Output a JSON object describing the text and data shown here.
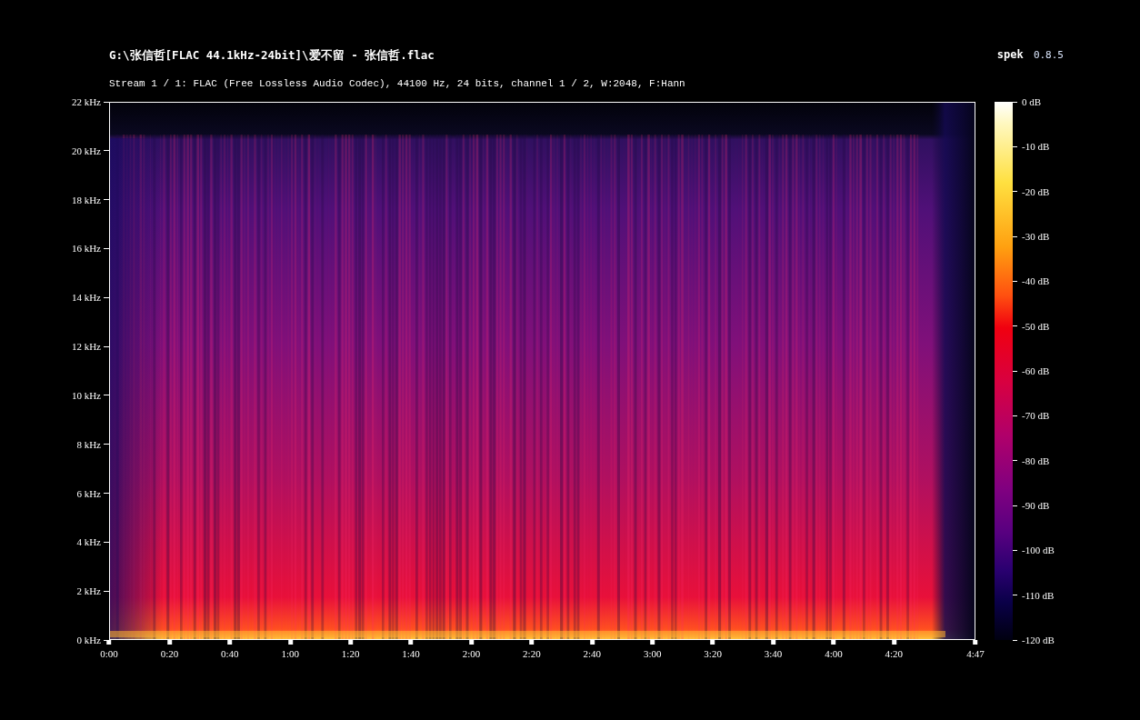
{
  "header": {
    "title": "G:\\张信哲[FLAC 44.1kHz-24bit]\\爱不留 - 张信哲.flac",
    "stream_info": "Stream 1 / 1: FLAC (Free Lossless Audio Codec), 44100 Hz, 24 bits, channel 1 / 2, W:2048, F:Hann",
    "app_name": "spek",
    "app_version": "0.8.5"
  },
  "frequency_axis": {
    "ticks": [
      "22 kHz",
      "20 kHz",
      "18 kHz",
      "16 kHz",
      "14 kHz",
      "12 kHz",
      "10 kHz",
      "8 kHz",
      "6 kHz",
      "4 kHz",
      "2 kHz",
      "0 kHz"
    ]
  },
  "time_axis": {
    "ticks": [
      "0:00",
      "0:20",
      "0:40",
      "1:00",
      "1:20",
      "1:40",
      "2:00",
      "2:20",
      "2:40",
      "3:00",
      "3:20",
      "3:40",
      "4:00",
      "4:20",
      "4:47"
    ]
  },
  "color_scale": {
    "ticks": [
      "0 dB",
      "-10 dB",
      "-20 dB",
      "-30 dB",
      "-40 dB",
      "-50 dB",
      "-60 dB",
      "-70 dB",
      "-80 dB",
      "-90 dB",
      "-100 dB",
      "-110 dB",
      "-120 dB"
    ]
  }
}
